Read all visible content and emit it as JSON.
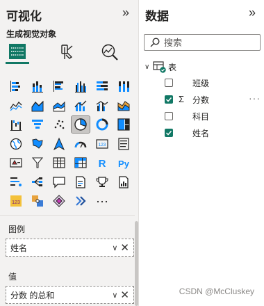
{
  "viz_pane": {
    "title": "可视化",
    "collapse_icon": "»",
    "build_label": "生成视觉对象",
    "tabs": [
      "build-visual",
      "format-visual",
      "analytics"
    ],
    "visuals": [
      "stacked-bar-chart",
      "stacked-column-chart",
      "clustered-bar-chart",
      "clustered-column-chart",
      "100-stacked-bar-chart",
      "100-stacked-column-chart",
      "line-chart",
      "area-chart",
      "stacked-area-chart",
      "line-and-stacked-column-chart",
      "line-and-clustered-column-chart",
      "ribbon-chart",
      "waterfall-chart",
      "funnel-chart",
      "scatter-chart",
      "pie-chart",
      "donut-chart",
      "treemap",
      "map",
      "filled-map",
      "azure-map",
      "gauge",
      "card",
      "multi-row-card",
      "kpi",
      "slicer",
      "table",
      "matrix",
      "r-visual",
      "python-visual",
      "key-influencers",
      "decomposition-tree",
      "qna",
      "smart-narrative",
      "metrics",
      "paginated-report",
      "power-apps",
      "power-automate",
      "arcgis-map",
      "get-more-visuals",
      "more-options-ellipsis"
    ],
    "selected_visual": "pie-chart",
    "more_label": "···",
    "legend_label": "图例",
    "legend_field": "姓名",
    "values_label": "值",
    "values_field": "分数 的总和"
  },
  "data_pane": {
    "title": "数据",
    "collapse_icon": "»",
    "search_placeholder": "搜索",
    "table_name": "表",
    "fields": [
      {
        "label": "班级",
        "checked": false,
        "sigma": false
      },
      {
        "label": "分数",
        "checked": true,
        "sigma": true
      },
      {
        "label": "科目",
        "checked": false,
        "sigma": false
      },
      {
        "label": "姓名",
        "checked": true,
        "sigma": false
      }
    ],
    "more_label": "···"
  },
  "watermark": "CSDN @McCluskey",
  "colors": {
    "accent": "#117865",
    "pane_bg": "#f3f2f1",
    "icon_blue": "#118dff",
    "icon_dark": "#252423"
  }
}
